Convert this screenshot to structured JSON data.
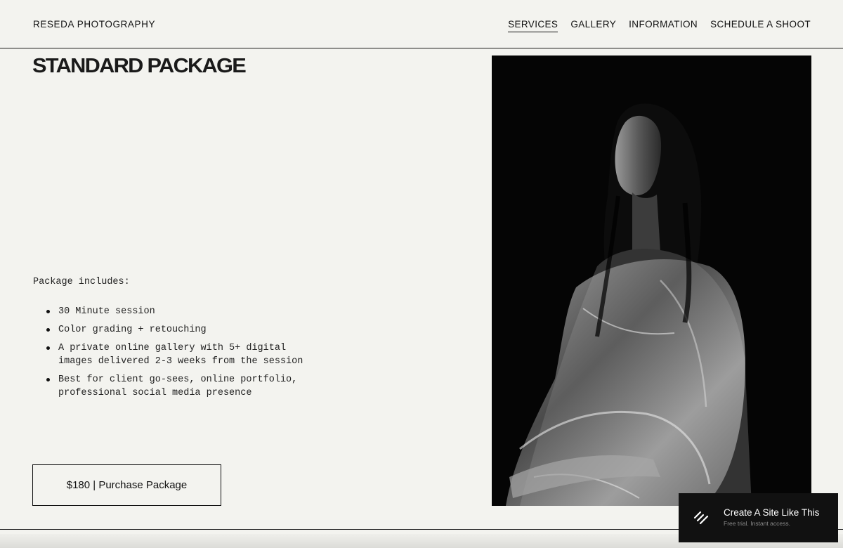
{
  "header": {
    "brand": "RESEDA PHOTOGRAPHY",
    "nav": [
      "SERVICES",
      "GALLERY",
      "INFORMATION",
      "SCHEDULE A SHOOT"
    ],
    "active_nav": "SERVICES"
  },
  "main": {
    "title": "STANDARD PACKAGE",
    "intro": "Package includes:",
    "features": [
      "30 Minute session",
      "Color grading + retouching",
      "A private online gallery with 5+ digital images delivered 2-3 weeks from the session",
      "Best for client go-sees, online portfolio, professional social media presence"
    ],
    "purchase_label": "$180 | Purchase Package"
  },
  "badge": {
    "title": "Create A Site Like This",
    "subtitle": "Free trial. Instant access.",
    "icon": "squarespace-logo-icon"
  },
  "colors": {
    "background": "#f3f3ef",
    "text": "#111111",
    "photo_bg": "#050505",
    "badge_bg": "#111111"
  }
}
